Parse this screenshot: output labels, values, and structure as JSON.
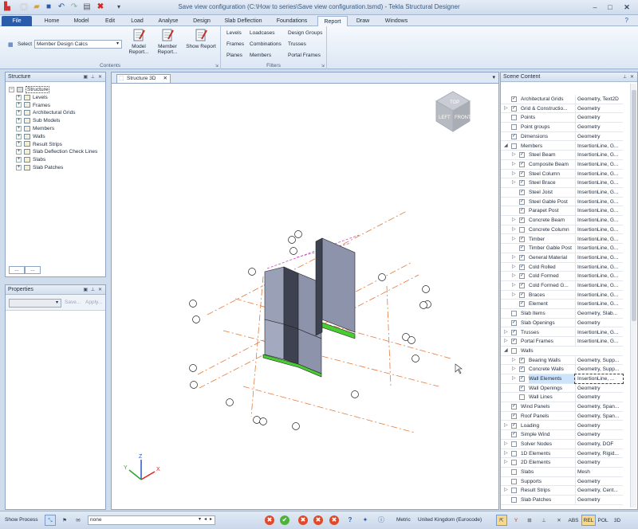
{
  "window": {
    "title": "Save view configuration (C:\\How to series\\Save view configuration.tsmd) - Tekla Structural Designer"
  },
  "tabs": [
    "File",
    "Home",
    "Model",
    "Edit",
    "Load",
    "Analyse",
    "Design",
    "Slab Deflection",
    "Foundations",
    "Report",
    "Draw",
    "Windows"
  ],
  "ribbon": {
    "select_label": "Select",
    "select_value": "Member Design Calcs",
    "model_report": "Model Report...",
    "member_report": "Member Report...",
    "show_report": "Show Report",
    "contents_label": "Contents",
    "filter_links": [
      [
        "Levels",
        "Loadcases",
        "Design Groups"
      ],
      [
        "Frames",
        "Combinations",
        "Trusses"
      ],
      [
        "Planes",
        "Members",
        "Portal Frames"
      ]
    ],
    "filters_label": "Filters"
  },
  "structure_panel": {
    "title": "Structure",
    "root": "Structure",
    "items": [
      "Levels",
      "Frames",
      "Architectural Grids",
      "Sub Models",
      "Members",
      "Walls",
      "Result Strips",
      "Slab Deflection Check Lines",
      "Slabs",
      "Slab Patches"
    ],
    "tab_button": "..."
  },
  "properties_panel": {
    "title": "Properties",
    "save": "Save...",
    "apply": "Apply..."
  },
  "viewport": {
    "tab": "Structure 3D",
    "cube": [
      "TOP",
      "LEFT",
      "FRONT"
    ],
    "axes": [
      "Z",
      "Y",
      "X"
    ]
  },
  "scene": {
    "title": "Scene Content",
    "rows": [
      {
        "name": "Architectural Grids",
        "desc": "Geometry, Text2D",
        "lvl": 0,
        "ex": "",
        "chk": true
      },
      {
        "name": "Grid & Constructio...",
        "desc": "Geometry",
        "lvl": 0,
        "ex": "▷",
        "chk": true
      },
      {
        "name": "Points",
        "desc": "Geometry",
        "lvl": 0,
        "ex": "",
        "chk": false
      },
      {
        "name": "Point groups",
        "desc": "Geometry",
        "lvl": 0,
        "ex": "",
        "chk": false
      },
      {
        "name": "Dimensions",
        "desc": "Geometry",
        "lvl": 0,
        "ex": "",
        "chk": true
      },
      {
        "name": "Members",
        "desc": "InsertionLine, G...",
        "lvl": 0,
        "ex": "◢",
        "chk": false
      },
      {
        "name": "Steel Beam",
        "desc": "InsertionLine, G...",
        "lvl": 1,
        "ex": "▷",
        "chk": true
      },
      {
        "name": "Composite Beam",
        "desc": "InsertionLine, G...",
        "lvl": 1,
        "ex": "▷",
        "chk": true
      },
      {
        "name": "Steel Column",
        "desc": "InsertionLine, G...",
        "lvl": 1,
        "ex": "▷",
        "chk": true
      },
      {
        "name": "Steel Brace",
        "desc": "InsertionLine, G...",
        "lvl": 1,
        "ex": "▷",
        "chk": true
      },
      {
        "name": "Steel Joist",
        "desc": "InsertionLine, G...",
        "lvl": 1,
        "ex": "",
        "chk": true
      },
      {
        "name": "Steel Gable Post",
        "desc": "InsertionLine, G...",
        "lvl": 1,
        "ex": "",
        "chk": true
      },
      {
        "name": "Parapet Post",
        "desc": "InsertionLine, G...",
        "lvl": 1,
        "ex": "",
        "chk": true
      },
      {
        "name": "Concrete Beam",
        "desc": "InsertionLine, G...",
        "lvl": 1,
        "ex": "▷",
        "chk": true
      },
      {
        "name": "Concrete Column",
        "desc": "InsertionLine, G...",
        "lvl": 1,
        "ex": "▷",
        "chk": false
      },
      {
        "name": "Timber",
        "desc": "InsertionLine, G...",
        "lvl": 1,
        "ex": "▷",
        "chk": true
      },
      {
        "name": "Timber Gable Post",
        "desc": "InsertionLine, G...",
        "lvl": 1,
        "ex": "",
        "chk": true
      },
      {
        "name": "General Material",
        "desc": "InsertionLine, G...",
        "lvl": 1,
        "ex": "▷",
        "chk": true
      },
      {
        "name": "Cold Rolled",
        "desc": "InsertionLine, G...",
        "lvl": 1,
        "ex": "▷",
        "chk": true
      },
      {
        "name": "Cold Formed",
        "desc": "InsertionLine, G...",
        "lvl": 1,
        "ex": "▷",
        "chk": true
      },
      {
        "name": "Cold Formed G...",
        "desc": "InsertionLine, G...",
        "lvl": 1,
        "ex": "▷",
        "chk": true
      },
      {
        "name": "Braces",
        "desc": "InsertionLine, G...",
        "lvl": 1,
        "ex": "▷",
        "chk": true
      },
      {
        "name": "Element",
        "desc": "InsertionLine, G...",
        "lvl": 1,
        "ex": "",
        "chk": true
      },
      {
        "name": "Slab Items",
        "desc": "Geometry, Slab...",
        "lvl": 0,
        "ex": "",
        "chk": false
      },
      {
        "name": "Slab Openings",
        "desc": "Geometry",
        "lvl": 0,
        "ex": "",
        "chk": true
      },
      {
        "name": "Trusses",
        "desc": "InsertionLine, G...",
        "lvl": 0,
        "ex": "▷",
        "chk": true
      },
      {
        "name": "Portal Frames",
        "desc": "InsertionLine, G...",
        "lvl": 0,
        "ex": "▷",
        "chk": true
      },
      {
        "name": "Walls",
        "desc": "",
        "lvl": 0,
        "ex": "◢",
        "chk": false
      },
      {
        "name": "Bearing Walls",
        "desc": "Geometry, Supp...",
        "lvl": 1,
        "ex": "▷",
        "chk": true
      },
      {
        "name": "Concrete Walls",
        "desc": "Geometry, Supp...",
        "lvl": 1,
        "ex": "▷",
        "chk": true
      },
      {
        "name": "Wall Elements",
        "desc": "InsertionLine, ...",
        "lvl": 1,
        "ex": "▷",
        "chk": true,
        "sel": true
      },
      {
        "name": "Wall Openings",
        "desc": "Geometry",
        "lvl": 1,
        "ex": "",
        "chk": true
      },
      {
        "name": "Wall Lines",
        "desc": "Geometry",
        "lvl": 1,
        "ex": "",
        "chk": false
      },
      {
        "name": "Wind Panels",
        "desc": "Geometry, Span...",
        "lvl": 0,
        "ex": "",
        "chk": true
      },
      {
        "name": "Roof Panels",
        "desc": "Geometry, Span...",
        "lvl": 0,
        "ex": "",
        "chk": true
      },
      {
        "name": "Loading",
        "desc": "Geometry",
        "lvl": 0,
        "ex": "▷",
        "chk": true
      },
      {
        "name": "Simple Wind",
        "desc": "Geometry",
        "lvl": 0,
        "ex": "",
        "chk": true
      },
      {
        "name": "Solver Nodes",
        "desc": "Geometry, DOF",
        "lvl": 0,
        "ex": "▷",
        "chk": false
      },
      {
        "name": "1D Elements",
        "desc": "Geometry, Rigid...",
        "lvl": 0,
        "ex": "▷",
        "chk": false
      },
      {
        "name": "2D Elements",
        "desc": "Geometry",
        "lvl": 0,
        "ex": "▷",
        "chk": false
      },
      {
        "name": "Slabs",
        "desc": "Mesh",
        "lvl": 0,
        "ex": "",
        "chk": false
      },
      {
        "name": "Supports",
        "desc": "Geometry",
        "lvl": 0,
        "ex": "",
        "chk": false
      },
      {
        "name": "Result Strips",
        "desc": "Geometry, Cent...",
        "lvl": 0,
        "ex": "▷",
        "chk": false
      },
      {
        "name": "Slab Patches",
        "desc": "Geometry",
        "lvl": 0,
        "ex": "",
        "chk": false
      }
    ]
  },
  "status": {
    "show_process": "Show Process",
    "filter_value": "none",
    "units": "Metric",
    "code": "United Kingdom (Eurocode)",
    "toggles": [
      "ABS",
      "REL",
      "POL",
      "3D"
    ]
  }
}
